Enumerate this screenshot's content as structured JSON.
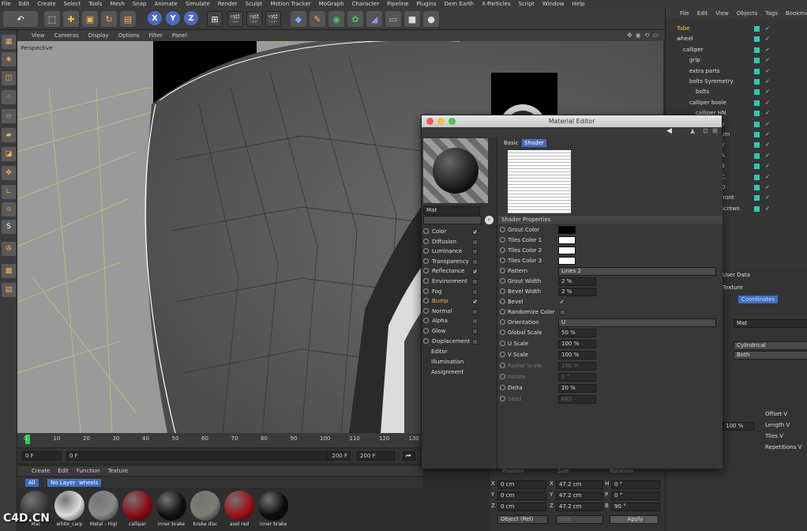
{
  "menubar": [
    "File",
    "Edit",
    "Create",
    "Select",
    "Tools",
    "Mesh",
    "Snap",
    "Animate",
    "Simulate",
    "Render",
    "Sculpt",
    "Motion Tracker",
    "MoGraph",
    "Character",
    "Pipeline",
    "Plugins",
    "Dem Earth",
    "X-Particles",
    "Script",
    "Window",
    "Help"
  ],
  "toolbar": {
    "x_label": "X",
    "y_label": "Y",
    "z_label": "Z"
  },
  "viewport": {
    "menu": [
      "View",
      "Cameras",
      "Display",
      "Options",
      "Filter",
      "Panel"
    ],
    "label": "Perspective"
  },
  "timeline": {
    "ticks": [
      "0",
      "10",
      "20",
      "30",
      "40",
      "50",
      "60",
      "70",
      "80",
      "90",
      "100",
      "110",
      "120",
      "130"
    ],
    "start": "0 F",
    "current": "0 F",
    "end": "200 F",
    "end2": "200 F"
  },
  "material_manager": {
    "menu": [
      "Create",
      "Edit",
      "Function",
      "Texture"
    ],
    "filters": [
      "All",
      "No Layer",
      "wheels"
    ],
    "materials": [
      {
        "label": "Mat",
        "color": "#3a3a3a"
      },
      {
        "label": "white_carp",
        "color": "#dcdcdc"
      },
      {
        "label": "Metal - Higl",
        "color": "#8a8a8a"
      },
      {
        "label": "callipar",
        "color": "#8f0d14"
      },
      {
        "label": "inner brake",
        "color": "#111111"
      },
      {
        "label": "brake disc",
        "color": "#7a7f72"
      },
      {
        "label": "axel red",
        "color": "#a01018"
      },
      {
        "label": "inner brake",
        "color": "#0d0d0d"
      }
    ]
  },
  "object_manager": {
    "menu": [
      "File",
      "Edit",
      "View",
      "Objects",
      "Tags",
      "Bookmarks"
    ],
    "items": [
      "Tube",
      "wheel",
      "calliper",
      "grip",
      "extra parts",
      "bolts Symmetry",
      "bolts",
      "calliper boole",
      "calliper HN",
      "Symmetry",
      "calliper Sym",
      "Symmetry",
      "A",
      "B",
      "C",
      "D",
      "front",
      "screws"
    ]
  },
  "attribute_manager": {
    "title": "User Data",
    "tab_texture": "Texture",
    "tab_coords": "Coordinates",
    "material_value": "Mat",
    "projection_value": "Cylindrical",
    "side_value": "Both",
    "offset_v": "Offset V",
    "length_v": "Length V",
    "tiles_v": "Tiles V",
    "repetitions_v": "Repetitions V",
    "length_val": "100 %"
  },
  "coordinates": {
    "headers": [
      "Position",
      "Size",
      "Rotation"
    ],
    "rows": [
      {
        "axis": "X",
        "pos": "0 cm",
        "size_axis": "X",
        "size": "47.2 cm",
        "rot_axis": "H",
        "rot": "0 °"
      },
      {
        "axis": "Y",
        "pos": "0 cm",
        "size_axis": "Y",
        "size": "47.2 cm",
        "rot_axis": "P",
        "rot": "0 °"
      },
      {
        "axis": "Z",
        "pos": "0 cm",
        "size_axis": "Z",
        "size": "47.2 cm",
        "rot_axis": "B",
        "rot": "90 °"
      }
    ],
    "mode": "Object (Rel)",
    "size_mode": "Size",
    "apply_label": "Apply"
  },
  "material_editor": {
    "title": "Material Editor",
    "mat_name": "Mat",
    "tab_basic": "Basic",
    "tab_shader": "Shader",
    "section": "Shader Properties",
    "channels": [
      {
        "label": "Color",
        "checked": true,
        "active": false
      },
      {
        "label": "Diffusion",
        "checked": false,
        "active": false
      },
      {
        "label": "Luminance",
        "checked": false,
        "active": false
      },
      {
        "label": "Transparency",
        "checked": false,
        "active": false
      },
      {
        "label": "Reflectance",
        "checked": true,
        "active": false
      },
      {
        "label": "Environment",
        "checked": false,
        "active": false
      },
      {
        "label": "Fog",
        "checked": false,
        "active": false
      },
      {
        "label": "Bump",
        "checked": true,
        "active": true
      },
      {
        "label": "Normal",
        "checked": false,
        "active": false
      },
      {
        "label": "Alpha",
        "checked": false,
        "active": false
      },
      {
        "label": "Glow",
        "checked": false,
        "active": false
      },
      {
        "label": "Displacement",
        "checked": false,
        "active": false
      }
    ],
    "extra": [
      "Editor",
      "Illumination",
      "Assignment"
    ],
    "props": {
      "grout_color": "Grout Color",
      "tiles_color_1": "Tiles Color 1",
      "tiles_color_2": "Tiles Color 2",
      "tiles_color_3": "Tiles Color 3",
      "pattern": "Pattern",
      "pattern_val": "Lines 2",
      "grout_width": "Grout Width",
      "grout_width_val": "2 %",
      "bevel_width": "Bevel Width",
      "bevel_width_val": "2 %",
      "bevel": "Bevel",
      "randomize_color": "Randomize Color",
      "orientation": "Orientation",
      "orientation_val": "U",
      "global_scale": "Global Scale",
      "global_scale_val": "50 %",
      "u_scale": "U Scale",
      "u_scale_val": "100 %",
      "v_scale": "V Scale",
      "v_scale_val": "100 %",
      "radial_scale": "Radial Scale",
      "radial_scale_val": "100 %",
      "rotate": "Rotate",
      "rotate_val": "0 °",
      "delta": "Delta",
      "delta_val": "20 %",
      "seed": "Seed",
      "seed_val": "665"
    }
  },
  "watermark": "C4D.CN"
}
